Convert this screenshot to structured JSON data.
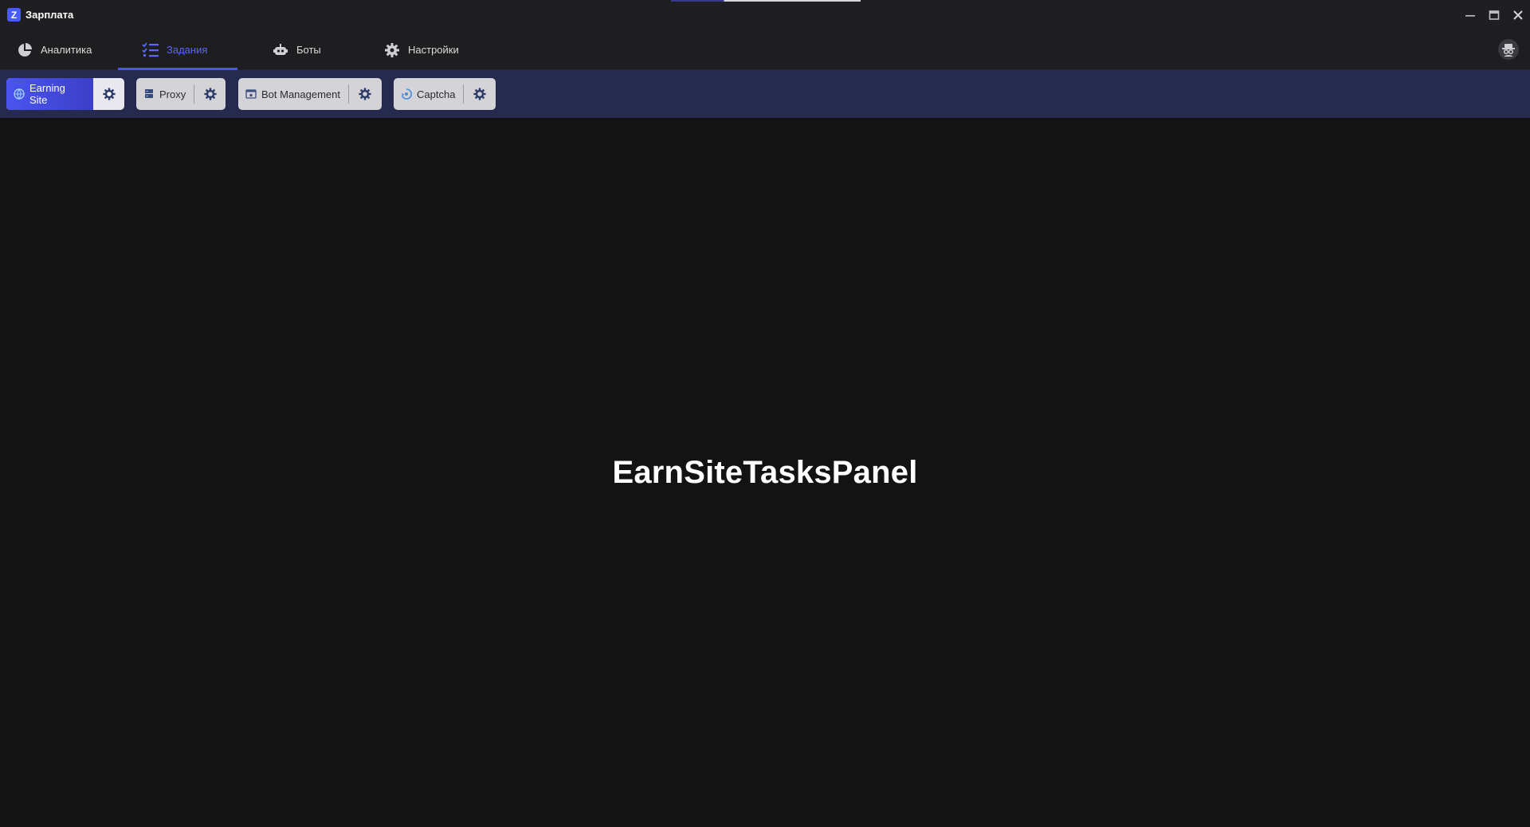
{
  "window": {
    "title": "Зарплата",
    "logo_letter": "Z"
  },
  "nav": {
    "tabs": [
      {
        "label": "Аналитика",
        "icon": "pie-chart-icon"
      },
      {
        "label": "Задания",
        "icon": "task-list-icon",
        "active": true
      },
      {
        "label": "Боты",
        "icon": "robot-icon"
      },
      {
        "label": "Настройки",
        "icon": "gear-icon"
      }
    ],
    "profile_icon": "spy-avatar-icon"
  },
  "toolbar": {
    "chips": [
      {
        "label": "Earning Site",
        "icon": "globe-icon",
        "active": true
      },
      {
        "label": "Proxy",
        "icon": "server-icon"
      },
      {
        "label": "Bot Management",
        "icon": "bot-window-icon"
      },
      {
        "label": "Captcha",
        "icon": "captcha-icon"
      }
    ]
  },
  "content": {
    "panel_label": "EarnSiteTasksPanel"
  },
  "colors": {
    "accent": "#4a55ff",
    "toolbar_bg": "#262a4f",
    "background": "#131313"
  }
}
